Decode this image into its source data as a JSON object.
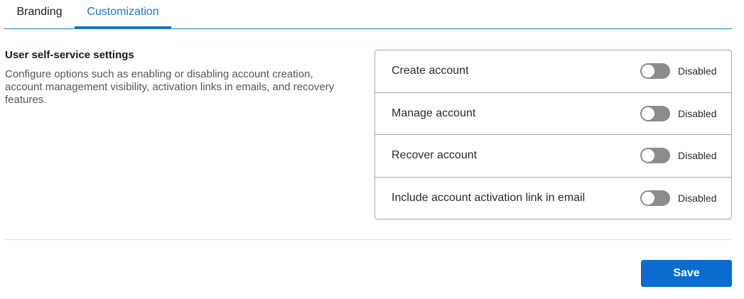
{
  "tabs": [
    {
      "label": "Branding",
      "active": false
    },
    {
      "label": "Customization",
      "active": true
    }
  ],
  "section": {
    "title": "User self-service settings",
    "description": "Configure options such as enabling or disabling account creation, account management visibility, activation links in emails, and recovery features."
  },
  "settings": [
    {
      "label": "Create account",
      "status": "Disabled",
      "enabled": false
    },
    {
      "label": "Manage account",
      "status": "Disabled",
      "enabled": false
    },
    {
      "label": "Recover account",
      "status": "Disabled",
      "enabled": false
    },
    {
      "label": "Include account activation link in email",
      "status": "Disabled",
      "enabled": false
    }
  ],
  "actions": {
    "save_label": "Save"
  },
  "colors": {
    "accent": "#1a73c4",
    "button": "#0a6ccf",
    "toggle_off": "#8c8c8c"
  }
}
